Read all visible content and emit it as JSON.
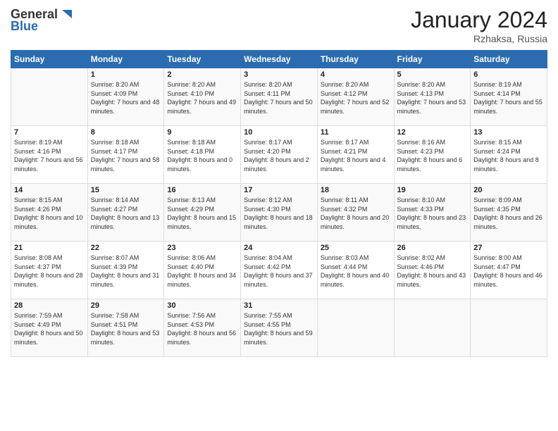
{
  "header": {
    "logo_general": "General",
    "logo_blue": "Blue",
    "month_title": "January 2024",
    "location": "Rzhaksa, Russia"
  },
  "days_of_week": [
    "Sunday",
    "Monday",
    "Tuesday",
    "Wednesday",
    "Thursday",
    "Friday",
    "Saturday"
  ],
  "weeks": [
    [
      {
        "day": "",
        "sunrise": "",
        "sunset": "",
        "daylight": ""
      },
      {
        "day": "1",
        "sunrise": "Sunrise: 8:20 AM",
        "sunset": "Sunset: 4:09 PM",
        "daylight": "Daylight: 7 hours and 48 minutes."
      },
      {
        "day": "2",
        "sunrise": "Sunrise: 8:20 AM",
        "sunset": "Sunset: 4:10 PM",
        "daylight": "Daylight: 7 hours and 49 minutes."
      },
      {
        "day": "3",
        "sunrise": "Sunrise: 8:20 AM",
        "sunset": "Sunset: 4:11 PM",
        "daylight": "Daylight: 7 hours and 50 minutes."
      },
      {
        "day": "4",
        "sunrise": "Sunrise: 8:20 AM",
        "sunset": "Sunset: 4:12 PM",
        "daylight": "Daylight: 7 hours and 52 minutes."
      },
      {
        "day": "5",
        "sunrise": "Sunrise: 8:20 AM",
        "sunset": "Sunset: 4:13 PM",
        "daylight": "Daylight: 7 hours and 53 minutes."
      },
      {
        "day": "6",
        "sunrise": "Sunrise: 8:19 AM",
        "sunset": "Sunset: 4:14 PM",
        "daylight": "Daylight: 7 hours and 55 minutes."
      }
    ],
    [
      {
        "day": "7",
        "sunrise": "Sunrise: 8:19 AM",
        "sunset": "Sunset: 4:16 PM",
        "daylight": "Daylight: 7 hours and 56 minutes."
      },
      {
        "day": "8",
        "sunrise": "Sunrise: 8:18 AM",
        "sunset": "Sunset: 4:17 PM",
        "daylight": "Daylight: 7 hours and 58 minutes."
      },
      {
        "day": "9",
        "sunrise": "Sunrise: 8:18 AM",
        "sunset": "Sunset: 4:18 PM",
        "daylight": "Daylight: 8 hours and 0 minutes."
      },
      {
        "day": "10",
        "sunrise": "Sunrise: 8:17 AM",
        "sunset": "Sunset: 4:20 PM",
        "daylight": "Daylight: 8 hours and 2 minutes."
      },
      {
        "day": "11",
        "sunrise": "Sunrise: 8:17 AM",
        "sunset": "Sunset: 4:21 PM",
        "daylight": "Daylight: 8 hours and 4 minutes."
      },
      {
        "day": "12",
        "sunrise": "Sunrise: 8:16 AM",
        "sunset": "Sunset: 4:23 PM",
        "daylight": "Daylight: 8 hours and 6 minutes."
      },
      {
        "day": "13",
        "sunrise": "Sunrise: 8:15 AM",
        "sunset": "Sunset: 4:24 PM",
        "daylight": "Daylight: 8 hours and 8 minutes."
      }
    ],
    [
      {
        "day": "14",
        "sunrise": "Sunrise: 8:15 AM",
        "sunset": "Sunset: 4:26 PM",
        "daylight": "Daylight: 8 hours and 10 minutes."
      },
      {
        "day": "15",
        "sunrise": "Sunrise: 8:14 AM",
        "sunset": "Sunset: 4:27 PM",
        "daylight": "Daylight: 8 hours and 13 minutes."
      },
      {
        "day": "16",
        "sunrise": "Sunrise: 8:13 AM",
        "sunset": "Sunset: 4:29 PM",
        "daylight": "Daylight: 8 hours and 15 minutes."
      },
      {
        "day": "17",
        "sunrise": "Sunrise: 8:12 AM",
        "sunset": "Sunset: 4:30 PM",
        "daylight": "Daylight: 8 hours and 18 minutes."
      },
      {
        "day": "18",
        "sunrise": "Sunrise: 8:11 AM",
        "sunset": "Sunset: 4:32 PM",
        "daylight": "Daylight: 8 hours and 20 minutes."
      },
      {
        "day": "19",
        "sunrise": "Sunrise: 8:10 AM",
        "sunset": "Sunset: 4:33 PM",
        "daylight": "Daylight: 8 hours and 23 minutes."
      },
      {
        "day": "20",
        "sunrise": "Sunrise: 8:09 AM",
        "sunset": "Sunset: 4:35 PM",
        "daylight": "Daylight: 8 hours and 26 minutes."
      }
    ],
    [
      {
        "day": "21",
        "sunrise": "Sunrise: 8:08 AM",
        "sunset": "Sunset: 4:37 PM",
        "daylight": "Daylight: 8 hours and 28 minutes."
      },
      {
        "day": "22",
        "sunrise": "Sunrise: 8:07 AM",
        "sunset": "Sunset: 4:39 PM",
        "daylight": "Daylight: 8 hours and 31 minutes."
      },
      {
        "day": "23",
        "sunrise": "Sunrise: 8:06 AM",
        "sunset": "Sunset: 4:40 PM",
        "daylight": "Daylight: 8 hours and 34 minutes."
      },
      {
        "day": "24",
        "sunrise": "Sunrise: 8:04 AM",
        "sunset": "Sunset: 4:42 PM",
        "daylight": "Daylight: 8 hours and 37 minutes."
      },
      {
        "day": "25",
        "sunrise": "Sunrise: 8:03 AM",
        "sunset": "Sunset: 4:44 PM",
        "daylight": "Daylight: 8 hours and 40 minutes."
      },
      {
        "day": "26",
        "sunrise": "Sunrise: 8:02 AM",
        "sunset": "Sunset: 4:46 PM",
        "daylight": "Daylight: 8 hours and 43 minutes."
      },
      {
        "day": "27",
        "sunrise": "Sunrise: 8:00 AM",
        "sunset": "Sunset: 4:47 PM",
        "daylight": "Daylight: 8 hours and 46 minutes."
      }
    ],
    [
      {
        "day": "28",
        "sunrise": "Sunrise: 7:59 AM",
        "sunset": "Sunset: 4:49 PM",
        "daylight": "Daylight: 8 hours and 50 minutes."
      },
      {
        "day": "29",
        "sunrise": "Sunrise: 7:58 AM",
        "sunset": "Sunset: 4:51 PM",
        "daylight": "Daylight: 8 hours and 53 minutes."
      },
      {
        "day": "30",
        "sunrise": "Sunrise: 7:56 AM",
        "sunset": "Sunset: 4:53 PM",
        "daylight": "Daylight: 8 hours and 56 minutes."
      },
      {
        "day": "31",
        "sunrise": "Sunrise: 7:55 AM",
        "sunset": "Sunset: 4:55 PM",
        "daylight": "Daylight: 8 hours and 59 minutes."
      },
      {
        "day": "",
        "sunrise": "",
        "sunset": "",
        "daylight": ""
      },
      {
        "day": "",
        "sunrise": "",
        "sunset": "",
        "daylight": ""
      },
      {
        "day": "",
        "sunrise": "",
        "sunset": "",
        "daylight": ""
      }
    ]
  ]
}
